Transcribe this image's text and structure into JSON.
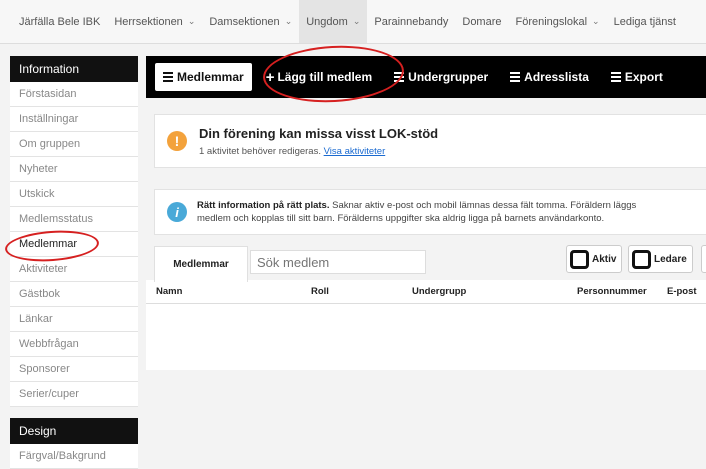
{
  "topnav": {
    "items": [
      {
        "label": "Järfälla Bele IBK",
        "dropdown": false
      },
      {
        "label": "Herrsektionen",
        "dropdown": true
      },
      {
        "label": "Damsektionen",
        "dropdown": true
      },
      {
        "label": "Ungdom",
        "dropdown": true,
        "active": true
      },
      {
        "label": "Parainnebandy",
        "dropdown": false
      },
      {
        "label": "Domare",
        "dropdown": false
      },
      {
        "label": "Föreningslokal",
        "dropdown": true
      },
      {
        "label": "Lediga tjänst",
        "dropdown": false
      }
    ]
  },
  "sidebar": {
    "information_header": "Information",
    "items": [
      "Förstasidan",
      "Inställningar",
      "Om gruppen",
      "Nyheter",
      "Utskick",
      "Medlemsstatus",
      "Medlemmar",
      "Aktiviteter",
      "Gästbok",
      "Länkar",
      "Webbfrågan",
      "Sponsorer",
      "Serier/cuper"
    ],
    "active_item": "Medlemmar",
    "design_header": "Design",
    "design_items": [
      "Färgval/Bakgrund"
    ]
  },
  "toolbar": {
    "members": "Medlemmar",
    "add_member": "Lägg till medlem",
    "subgroups": "Undergrupper",
    "address_list": "Adresslista",
    "export": "Export"
  },
  "alert": {
    "title": "Din förening kan missa visst LOK-stöd",
    "text": "1 aktivitet behöver redigeras.",
    "link": "Visa aktiviteter"
  },
  "info": {
    "bold": "Rätt information på rätt plats.",
    "line1": " Saknar aktiv e-post och mobil lämnas dessa fält tomma. Föräldern läggs",
    "line2": "medlem och kopplas till sitt barn. Förälderns uppgifter ska aldrig ligga på barnets användarkonto."
  },
  "table": {
    "tab_label": "Medlemmar",
    "search_placeholder": "Sök medlem",
    "filter_active": "Aktiv",
    "filter_leader": "Ledare",
    "columns": [
      "Namn",
      "Roll",
      "Undergrupp",
      "Personnummer",
      "E-post"
    ]
  },
  "colors": {
    "toolbar_bg": "#000000",
    "alert_icon": "#f3a23c",
    "info_icon": "#49a9d8",
    "annotation": "#d62020"
  }
}
